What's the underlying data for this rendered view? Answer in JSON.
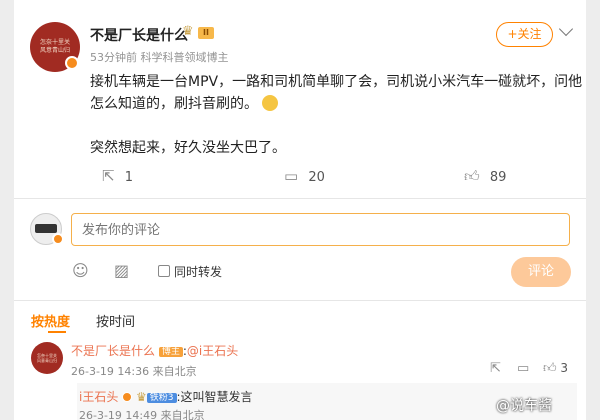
{
  "post": {
    "author": "不是厂长是什么",
    "level_badge": "II",
    "avatar_text": "怎奈十里关 风意青山归",
    "time": "53分钟前",
    "category": "科学科普领域博主",
    "follow_label": "+关注",
    "text_line1": "接机车辆是一台MPV，一路和司机简单聊了会，司机说小米汽车一碰就坏，问他",
    "text_line2": "怎么知道的，刷抖音刷的。",
    "text_line3": "突然想起来，好久没坐大巴了。",
    "share_count": "1",
    "comment_count": "20",
    "like_count": "89"
  },
  "composer": {
    "placeholder": "发布你的评论",
    "repost_label": "同时转发",
    "submit_label": "评论"
  },
  "tabs": {
    "hot": "按热度",
    "time": "按时间"
  },
  "comments": [
    {
      "author": "不是厂长是什么",
      "author_tag": "博主",
      "text_prefix": ":",
      "mention": "@i王石头",
      "time": "26-3-19 14:36",
      "location": "来自北京",
      "likes": "3"
    }
  ],
  "reply": {
    "author": "i王石头",
    "author_tag": "铁粉3",
    "text": ":这叫智慧发言",
    "time": "26-3-19 14:49",
    "location": "来自北京"
  },
  "watermark": "@说车酱",
  "colors": {
    "accent": "#ff8200",
    "link": "#eb7350",
    "avatar_bg": "#a12b22"
  }
}
